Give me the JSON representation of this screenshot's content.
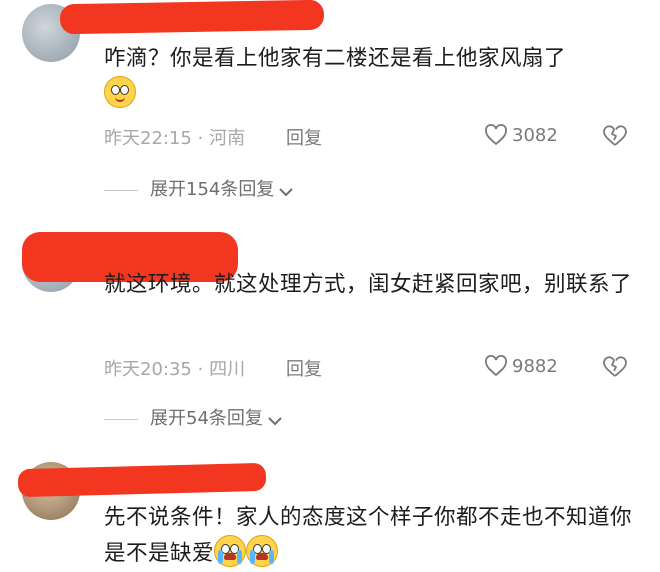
{
  "comments": [
    {
      "text": "咋滴？你是看上他家有二楼还是看上他家风扇了",
      "emojis": [
        "smile"
      ],
      "time": "昨天22:15",
      "separator": "·",
      "location": "河南",
      "reply_label": "回复",
      "likes": "3082",
      "expand_label": "展开154条回复"
    },
    {
      "text": "就这环境。就这处理方式，闺女赶紧回家吧，别联系了",
      "emojis": [],
      "time": "昨天20:35",
      "separator": "·",
      "location": "四川",
      "reply_label": "回复",
      "likes": "9882",
      "expand_label": "展开54条回复"
    },
    {
      "text": "先不说条件！家人的态度这个样子你都不走也不知道你是不是缺爱",
      "emojis": [
        "crying-laughing",
        "crying-laughing"
      ]
    }
  ],
  "colors": {
    "redact": "#f2361f",
    "meta": "#a7a7a7",
    "action": "#7a7a7a"
  }
}
